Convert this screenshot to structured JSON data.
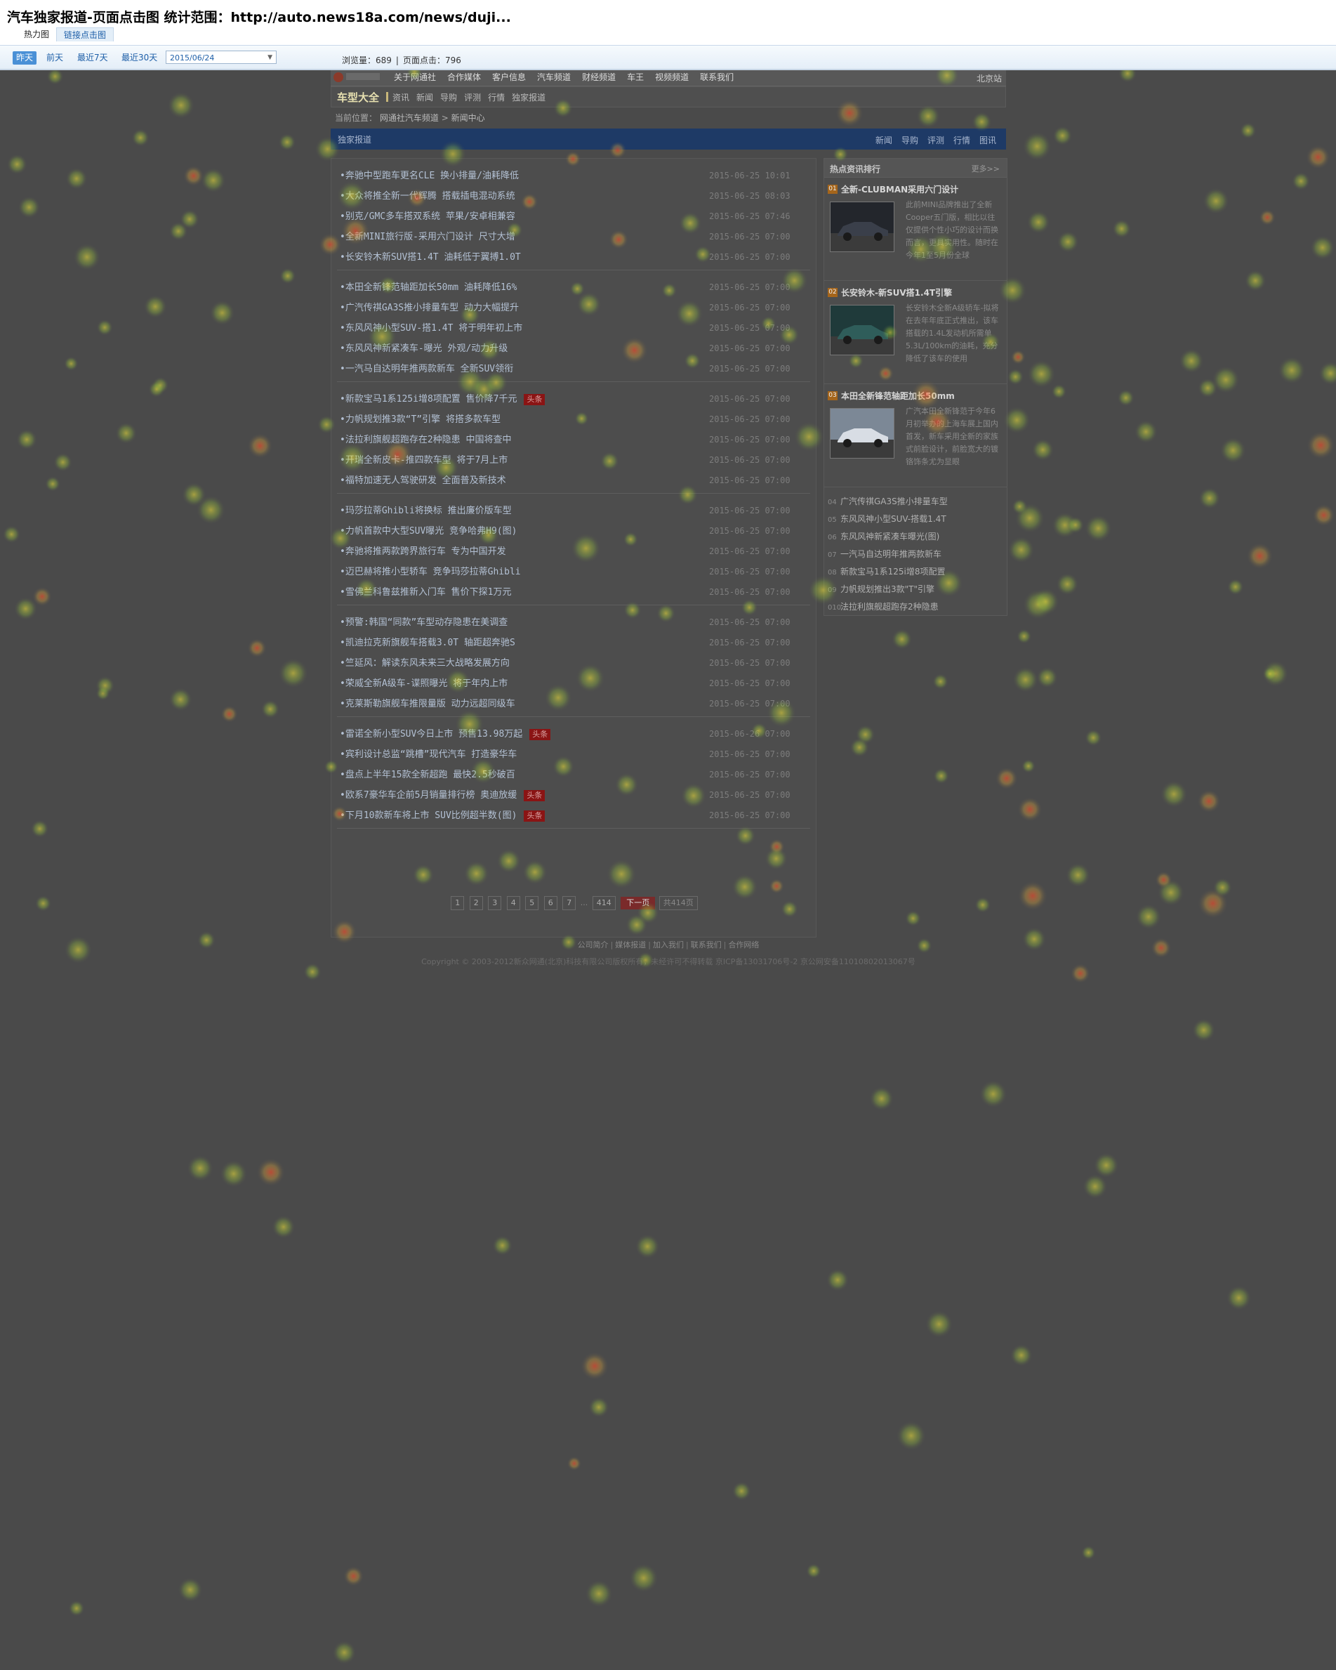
{
  "analytics": {
    "page_title": "汽车独家报道-页面点击图 统计范围：http://auto.news18a.com/news/duji...",
    "mode_tabs": [
      "热力图",
      "链接点击图"
    ],
    "ranges": [
      "昨天",
      "前天",
      "最近7天",
      "最近30天"
    ],
    "date_value": "2015/06/24",
    "stats_views": "浏览量：689",
    "stats_clicks": "页面点击：796"
  },
  "site": {
    "nav_links": [
      "关于网通社",
      "合作媒体",
      "客户信息",
      "汽车频道",
      "财经频道",
      "车王",
      "视频频道",
      "联系我们"
    ],
    "city": "北京站",
    "subnav_brand": "车型大全",
    "subnav_links": [
      "资讯",
      "新闻",
      "导购",
      "评测",
      "行情",
      "独家报道"
    ],
    "breadcrumb_label": "当前位置：",
    "breadcrumb_items": [
      "网通社汽车频道",
      ">",
      "新闻中心"
    ],
    "section_title": "独家报道",
    "section_links": [
      "新闻",
      "导购",
      "评测",
      "行情",
      "图讯"
    ]
  },
  "news_groups": [
    [
      {
        "title": "•奔驰中型跑车更名CLE 换小排量/油耗降低",
        "date": "2015-06-25 10:01"
      },
      {
        "title": "•大众将推全新一代辉腾 搭载插电混动系统",
        "date": "2015-06-25 08:03"
      },
      {
        "title": "•别克/GMC多车搭双系统 苹果/安卓相兼容",
        "date": "2015-06-25 07:46"
      },
      {
        "title": "•全新MINI旅行版-采用六门设计 尺寸大增",
        "date": "2015-06-25 07:00"
      },
      {
        "title": "•长安铃木新SUV搭1.4T 油耗低于翼搏1.0T",
        "date": "2015-06-25 07:00"
      }
    ],
    [
      {
        "title": "•本田全新锋范轴距加长50mm 油耗降低16%",
        "date": "2015-06-25 07:00"
      },
      {
        "title": "•广汽传祺GA3S推小排量车型 动力大幅提升",
        "date": "2015-06-25 07:00"
      },
      {
        "title": "•东风风神小型SUV-搭1.4T 将于明年初上市",
        "date": "2015-06-25 07:00"
      },
      {
        "title": "•东风风神新紧凑车-曝光 外观/动力升级",
        "date": "2015-06-25 07:00"
      },
      {
        "title": "•一汽马自达明年推两款新车 全新SUV领衔",
        "date": "2015-06-25 07:00"
      }
    ],
    [
      {
        "title": "•新款宝马1系125i增8项配置 售价降7千元",
        "date": "2015-06-25 07:00",
        "tag": "头条"
      },
      {
        "title": "•力帆规划推3款“T”引擎 将搭多款车型",
        "date": "2015-06-25 07:00"
      },
      {
        "title": "•法拉利旗舰超跑存在2种隐患 中国将查中",
        "date": "2015-06-25 07:00"
      },
      {
        "title": "•开瑞全新皮卡-推四款车型 将于7月上市",
        "date": "2015-06-25 07:00"
      },
      {
        "title": "•福特加速无人驾驶研发 全面普及新技术",
        "date": "2015-06-25 07:00"
      }
    ],
    [
      {
        "title": "•玛莎拉蒂Ghibli将换标 推出廉价版车型",
        "date": "2015-06-25 07:00"
      },
      {
        "title": "•力帆首款中大型SUV曝光 竞争哈弗H9(图)",
        "date": "2015-06-25 07:00"
      },
      {
        "title": "•奔驰将推两款跨界旅行车 专为中国开发",
        "date": "2015-06-25 07:00"
      },
      {
        "title": "•迈巴赫将推小型轿车 竞争玛莎拉蒂Ghibli",
        "date": "2015-06-25 07:00"
      },
      {
        "title": "•雪佛兰科鲁兹推新入门车 售价下探1万元",
        "date": "2015-06-25 07:00"
      }
    ],
    [
      {
        "title": "•预警:韩国“同款”车型动存隐患在美调查",
        "date": "2015-06-25 07:00"
      },
      {
        "title": "•凯迪拉克新旗舰车搭载3.0T 轴距超奔驰S",
        "date": "2015-06-25 07:00"
      },
      {
        "title": "•竺延风：解读东风未来三大战略发展方向",
        "date": "2015-06-25 07:00"
      },
      {
        "title": "•荣威全新A级车-谍照曝光 将于年内上市",
        "date": "2015-06-25 07:00"
      },
      {
        "title": "•克莱斯勒旗舰车推限量版 动力远超同级车",
        "date": "2015-06-25 07:00"
      }
    ],
    [
      {
        "title": "•雷诺全新小型SUV今日上市 预售13.98万起",
        "date": "2015-06-26 07:00",
        "tag": "头条"
      },
      {
        "title": "•宾利设计总监“跳槽”现代汽车 打造豪华车",
        "date": "2015-06-25 07:00"
      },
      {
        "title": "•盘点上半年15款全新超跑 最快2.5秒破百",
        "date": "2015-06-25 07:00"
      },
      {
        "title": "•欧系7豪华车企前5月销量排行榜 奥迪放缓",
        "date": "2015-06-25 07:00",
        "tag": "头条"
      },
      {
        "title": "•下月10款新车将上市 SUV比例超半数(图)",
        "date": "2015-06-25 07:00",
        "tag": "头条"
      }
    ]
  ],
  "pagination": {
    "pages": [
      "1",
      "2",
      "3",
      "4",
      "5",
      "6",
      "7"
    ],
    "ellipsis": "...",
    "last": "414",
    "next": "下一页",
    "total": "共414页"
  },
  "sidebar": {
    "title": "热点资讯排行",
    "more": "更多>>",
    "features": [
      {
        "num": "01",
        "title": "全新-CLUBMAN采用六门设计",
        "desc": "此前MINI品牌推出了全新Cooper五门版，相比以往仅提供个性小巧的设计而换而言，更具实用性。随时在今年1至5月份全球"
      },
      {
        "num": "02",
        "title": "长安铃木-新SUV搭1.4T引擎",
        "desc": "长安铃木全新A级轿车-拟将在去年年底正式推出，该车搭载的1.4L发动机所需单5.3L/100km的油耗，充分降低了该车的使用"
      },
      {
        "num": "03",
        "title": "本田全新锋范轴距加长50mm",
        "desc": "广汽本田全新锋范于今年6月初举办的上海车展上国内首发，新车采用全新的家族式前脸设计，前脸宽大的镀铬饰条尤为显眼"
      }
    ],
    "rank_items": [
      {
        "num": "04",
        "text": "广汽传祺GA3S推小排量车型"
      },
      {
        "num": "05",
        "text": "东风风神小型SUV-搭载1.4T"
      },
      {
        "num": "06",
        "text": "东风风神新紧凑车曝光(图)"
      },
      {
        "num": "07",
        "text": "一汽马自达明年推两款新车"
      },
      {
        "num": "08",
        "text": "新款宝马1系125i增8项配置"
      },
      {
        "num": "09",
        "text": "力帆规划推出3款\"T\"引擎"
      },
      {
        "num": "010",
        "text": "法拉利旗舰超跑存2种隐患"
      }
    ]
  },
  "footer": {
    "links": [
      "公司简介",
      "|",
      "媒体报道",
      "|",
      "加入我们",
      "|",
      "联系我们",
      "|",
      "合作网络"
    ],
    "copyright": "Copyright © 2003-2012新众网通(北京)科技有限公司版权所有，未经许可不得转载 京ICP备13031706号-2 京公网安备11010802013067号"
  }
}
